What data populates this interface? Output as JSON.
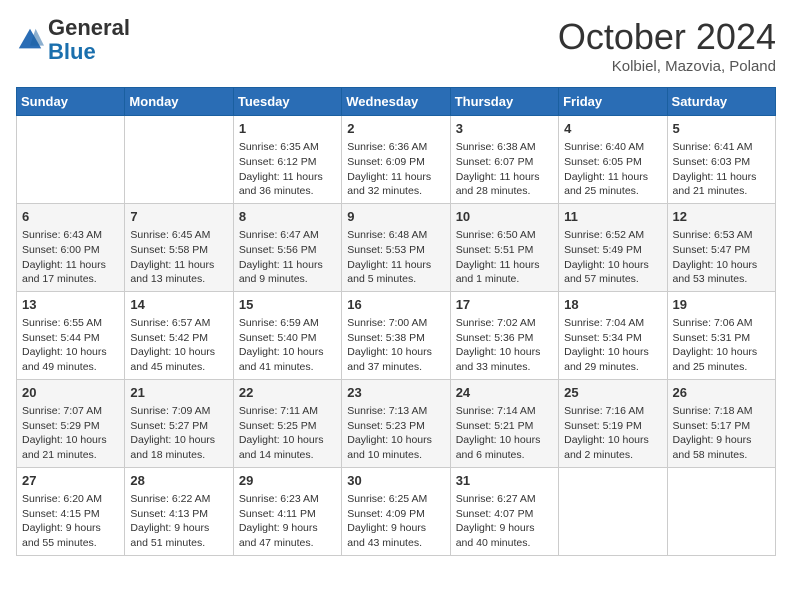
{
  "header": {
    "logo_general": "General",
    "logo_blue": "Blue",
    "month": "October 2024",
    "location": "Kolbiel, Mazovia, Poland"
  },
  "days_of_week": [
    "Sunday",
    "Monday",
    "Tuesday",
    "Wednesday",
    "Thursday",
    "Friday",
    "Saturday"
  ],
  "weeks": [
    [
      {
        "day": "",
        "info": ""
      },
      {
        "day": "",
        "info": ""
      },
      {
        "day": "1",
        "info": "Sunrise: 6:35 AM\nSunset: 6:12 PM\nDaylight: 11 hours and 36 minutes."
      },
      {
        "day": "2",
        "info": "Sunrise: 6:36 AM\nSunset: 6:09 PM\nDaylight: 11 hours and 32 minutes."
      },
      {
        "day": "3",
        "info": "Sunrise: 6:38 AM\nSunset: 6:07 PM\nDaylight: 11 hours and 28 minutes."
      },
      {
        "day": "4",
        "info": "Sunrise: 6:40 AM\nSunset: 6:05 PM\nDaylight: 11 hours and 25 minutes."
      },
      {
        "day": "5",
        "info": "Sunrise: 6:41 AM\nSunset: 6:03 PM\nDaylight: 11 hours and 21 minutes."
      }
    ],
    [
      {
        "day": "6",
        "info": "Sunrise: 6:43 AM\nSunset: 6:00 PM\nDaylight: 11 hours and 17 minutes."
      },
      {
        "day": "7",
        "info": "Sunrise: 6:45 AM\nSunset: 5:58 PM\nDaylight: 11 hours and 13 minutes."
      },
      {
        "day": "8",
        "info": "Sunrise: 6:47 AM\nSunset: 5:56 PM\nDaylight: 11 hours and 9 minutes."
      },
      {
        "day": "9",
        "info": "Sunrise: 6:48 AM\nSunset: 5:53 PM\nDaylight: 11 hours and 5 minutes."
      },
      {
        "day": "10",
        "info": "Sunrise: 6:50 AM\nSunset: 5:51 PM\nDaylight: 11 hours and 1 minute."
      },
      {
        "day": "11",
        "info": "Sunrise: 6:52 AM\nSunset: 5:49 PM\nDaylight: 10 hours and 57 minutes."
      },
      {
        "day": "12",
        "info": "Sunrise: 6:53 AM\nSunset: 5:47 PM\nDaylight: 10 hours and 53 minutes."
      }
    ],
    [
      {
        "day": "13",
        "info": "Sunrise: 6:55 AM\nSunset: 5:44 PM\nDaylight: 10 hours and 49 minutes."
      },
      {
        "day": "14",
        "info": "Sunrise: 6:57 AM\nSunset: 5:42 PM\nDaylight: 10 hours and 45 minutes."
      },
      {
        "day": "15",
        "info": "Sunrise: 6:59 AM\nSunset: 5:40 PM\nDaylight: 10 hours and 41 minutes."
      },
      {
        "day": "16",
        "info": "Sunrise: 7:00 AM\nSunset: 5:38 PM\nDaylight: 10 hours and 37 minutes."
      },
      {
        "day": "17",
        "info": "Sunrise: 7:02 AM\nSunset: 5:36 PM\nDaylight: 10 hours and 33 minutes."
      },
      {
        "day": "18",
        "info": "Sunrise: 7:04 AM\nSunset: 5:34 PM\nDaylight: 10 hours and 29 minutes."
      },
      {
        "day": "19",
        "info": "Sunrise: 7:06 AM\nSunset: 5:31 PM\nDaylight: 10 hours and 25 minutes."
      }
    ],
    [
      {
        "day": "20",
        "info": "Sunrise: 7:07 AM\nSunset: 5:29 PM\nDaylight: 10 hours and 21 minutes."
      },
      {
        "day": "21",
        "info": "Sunrise: 7:09 AM\nSunset: 5:27 PM\nDaylight: 10 hours and 18 minutes."
      },
      {
        "day": "22",
        "info": "Sunrise: 7:11 AM\nSunset: 5:25 PM\nDaylight: 10 hours and 14 minutes."
      },
      {
        "day": "23",
        "info": "Sunrise: 7:13 AM\nSunset: 5:23 PM\nDaylight: 10 hours and 10 minutes."
      },
      {
        "day": "24",
        "info": "Sunrise: 7:14 AM\nSunset: 5:21 PM\nDaylight: 10 hours and 6 minutes."
      },
      {
        "day": "25",
        "info": "Sunrise: 7:16 AM\nSunset: 5:19 PM\nDaylight: 10 hours and 2 minutes."
      },
      {
        "day": "26",
        "info": "Sunrise: 7:18 AM\nSunset: 5:17 PM\nDaylight: 9 hours and 58 minutes."
      }
    ],
    [
      {
        "day": "27",
        "info": "Sunrise: 6:20 AM\nSunset: 4:15 PM\nDaylight: 9 hours and 55 minutes."
      },
      {
        "day": "28",
        "info": "Sunrise: 6:22 AM\nSunset: 4:13 PM\nDaylight: 9 hours and 51 minutes."
      },
      {
        "day": "29",
        "info": "Sunrise: 6:23 AM\nSunset: 4:11 PM\nDaylight: 9 hours and 47 minutes."
      },
      {
        "day": "30",
        "info": "Sunrise: 6:25 AM\nSunset: 4:09 PM\nDaylight: 9 hours and 43 minutes."
      },
      {
        "day": "31",
        "info": "Sunrise: 6:27 AM\nSunset: 4:07 PM\nDaylight: 9 hours and 40 minutes."
      },
      {
        "day": "",
        "info": ""
      },
      {
        "day": "",
        "info": ""
      }
    ]
  ]
}
